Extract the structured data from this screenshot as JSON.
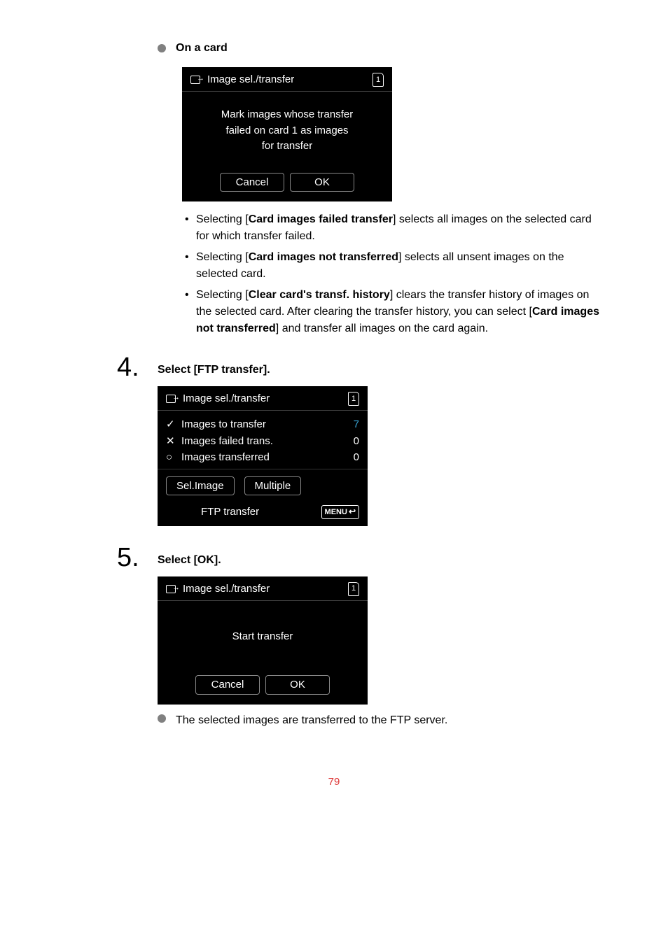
{
  "section": {
    "on_card_heading": "On a card"
  },
  "screen1": {
    "title": "Image sel./transfer",
    "card_num": "1",
    "msg_l1": "Mark images whose transfer",
    "msg_l2": "failed on card 1 as images",
    "msg_l3": "for transfer",
    "cancel": "Cancel",
    "ok": "OK"
  },
  "bullets": {
    "b1a": "Selecting [",
    "b1b": "Card images failed transfer",
    "b1c": "] selects all images on the selected card for which transfer failed.",
    "b2a": "Selecting [",
    "b2b": "Card images not transferred",
    "b2c": "] selects all unsent images on the selected card.",
    "b3a": "Selecting [",
    "b3b": "Clear card's transf. history",
    "b3c": "] clears the transfer history of images on the selected card. After clearing the transfer history, you can select [",
    "b3d": "Card images not transferred",
    "b3e": "] and transfer all images on the card again."
  },
  "step4": {
    "num": "4.",
    "title": "Select [FTP transfer].",
    "screen_title": "Image sel./transfer",
    "card_num": "1",
    "row_to_transfer": "Images to transfer",
    "row_to_transfer_val": "7",
    "row_failed": "Images failed trans.",
    "row_failed_val": "0",
    "row_transferred": "Images transferred",
    "row_transferred_val": "0",
    "sel_image": "Sel.Image",
    "multiple": "Multiple",
    "ftp_transfer": "FTP transfer",
    "menu": "MENU"
  },
  "step5": {
    "num": "5.",
    "title": "Select [OK].",
    "screen_title": "Image sel./transfer",
    "card_num": "1",
    "start_msg": "Start transfer",
    "cancel": "Cancel",
    "ok": "OK",
    "note": "The selected images are transferred to the FTP server."
  },
  "page_num": "79"
}
